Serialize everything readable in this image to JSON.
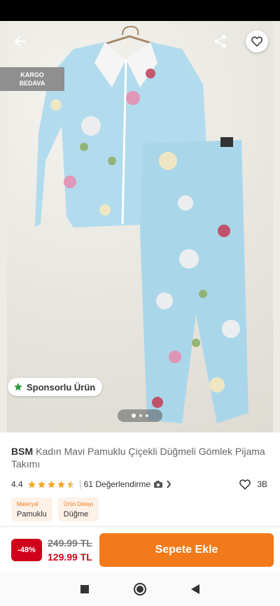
{
  "badges": {
    "cargo_line1": "KARGO",
    "cargo_line2": "BEDAVA",
    "sponsored": "Sponsorlu Ürün"
  },
  "gallery": {
    "dots_total": 3,
    "active_dot": 1
  },
  "product": {
    "brand": "BSM",
    "name": "Kadın Mavi Pamuklu Çiçekli Düğmeli Gömlek Pijama Takımı",
    "rating": "4.4",
    "rating_value": 4.4,
    "reviews": "61 Değerlendirme",
    "favorites": "3B",
    "attributes": [
      {
        "key": "Materyal",
        "value": "Pamuklu"
      },
      {
        "key": "Ürün Detayı",
        "value": "Düğme"
      }
    ]
  },
  "pricing": {
    "discount": "-48%",
    "old_price": "249.99 TL",
    "new_price": "129.99 TL",
    "cart_label": "Sepete Ekle"
  },
  "icons": {
    "back": "arrow-left-icon",
    "share": "share-icon",
    "favorite": "heart-icon",
    "sponsor": "star-icon",
    "camera": "camera-icon",
    "chevron": "chevron-right-icon"
  },
  "colors": {
    "accent": "#f27a1a",
    "discount": "#d0021b",
    "star": "#f5a623",
    "fabric": "#aed9ee"
  }
}
